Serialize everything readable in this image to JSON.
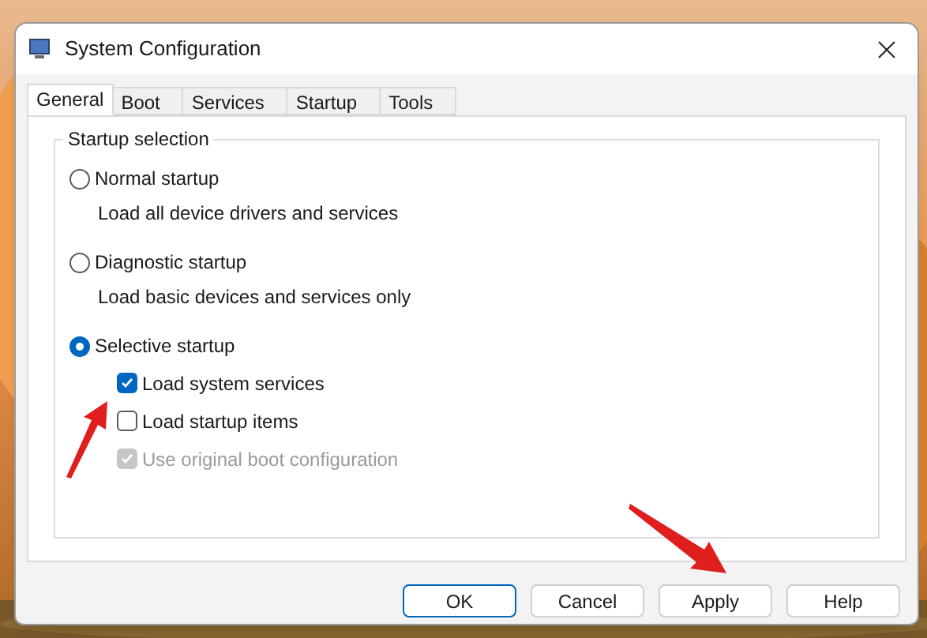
{
  "window": {
    "title": "System Configuration"
  },
  "tabs": [
    {
      "label": "General",
      "selected": true
    },
    {
      "label": "Boot",
      "selected": false
    },
    {
      "label": "Services",
      "selected": false
    },
    {
      "label": "Startup",
      "selected": false
    },
    {
      "label": "Tools",
      "selected": false
    }
  ],
  "group": {
    "title": "Startup selection",
    "options": [
      {
        "label": "Normal startup",
        "selected": false,
        "description": "Load all device drivers and services"
      },
      {
        "label": "Diagnostic startup",
        "selected": false,
        "description": "Load basic devices and services only"
      },
      {
        "label": "Selective startup",
        "selected": true,
        "children": [
          {
            "label": "Load system services",
            "checked": true,
            "disabled": false
          },
          {
            "label": "Load startup items",
            "checked": false,
            "disabled": false
          },
          {
            "label": "Use original boot configuration",
            "checked": true,
            "disabled": true
          }
        ]
      }
    ]
  },
  "buttons": [
    {
      "label": "OK",
      "default": true
    },
    {
      "label": "Cancel",
      "default": false
    },
    {
      "label": "Apply",
      "default": false
    },
    {
      "label": "Help",
      "default": false
    }
  ]
}
